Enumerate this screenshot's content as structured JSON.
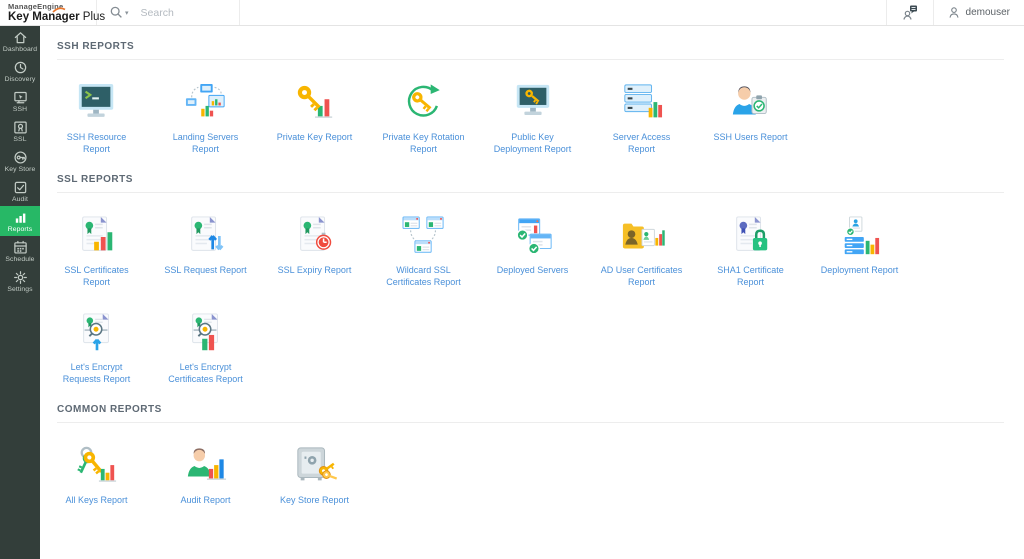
{
  "header": {
    "brand": {
      "line1": "ManageEngine",
      "line2": "Key Manager",
      "line2_suffix": "Plus"
    },
    "search": {
      "placeholder": "Search"
    },
    "user": {
      "name": "demouser"
    }
  },
  "sidebar": {
    "items": [
      {
        "label": "Dashboard",
        "icon": "home",
        "active": false
      },
      {
        "label": "Discovery",
        "icon": "discovery",
        "active": false
      },
      {
        "label": "SSH",
        "icon": "ssh",
        "active": false
      },
      {
        "label": "SSL",
        "icon": "ssl",
        "active": false
      },
      {
        "label": "Key Store",
        "icon": "keystore",
        "active": false
      },
      {
        "label": "Audit",
        "icon": "audit",
        "active": false
      },
      {
        "label": "Reports",
        "icon": "reports",
        "active": true
      },
      {
        "label": "Schedule",
        "icon": "schedule",
        "active": false
      },
      {
        "label": "Settings",
        "icon": "settings",
        "active": false
      }
    ]
  },
  "sections": [
    {
      "title": "SSH REPORTS",
      "reports": [
        {
          "label": "SSH Resource Report",
          "icon": "ssh-resource"
        },
        {
          "label": "Landing Servers Report",
          "icon": "landing-servers"
        },
        {
          "label": "Private Key Report",
          "icon": "private-key"
        },
        {
          "label": "Private Key Rotation Report",
          "icon": "private-key-rotation"
        },
        {
          "label": "Public Key Deployment Report",
          "icon": "public-key-deployment"
        },
        {
          "label": "Server Access Report",
          "icon": "server-access"
        },
        {
          "label": "SSH Users Report",
          "icon": "ssh-users"
        }
      ]
    },
    {
      "title": "SSL REPORTS",
      "reports": [
        {
          "label": "SSL Certificates Report",
          "icon": "ssl-certificates"
        },
        {
          "label": "SSL Request Report",
          "icon": "ssl-request"
        },
        {
          "label": "SSL Expiry Report",
          "icon": "ssl-expiry"
        },
        {
          "label": "Wildcard SSL Certificates Report",
          "icon": "wildcard-ssl"
        },
        {
          "label": "Deployed Servers",
          "icon": "deployed-servers"
        },
        {
          "label": "AD User Certificates Report",
          "icon": "ad-user-certificates"
        },
        {
          "label": "SHA1 Certificate Report",
          "icon": "sha1-certificate"
        },
        {
          "label": "Deployment Report",
          "icon": "deployment"
        },
        {
          "label": "Let's Encrypt Requests Report",
          "icon": "lets-encrypt-requests"
        },
        {
          "label": "Let's Encrypt Certificates Report",
          "icon": "lets-encrypt-certificates"
        }
      ]
    },
    {
      "title": "COMMON REPORTS",
      "reports": [
        {
          "label": "All Keys Report",
          "icon": "all-keys"
        },
        {
          "label": "Audit Report",
          "icon": "audit-person"
        },
        {
          "label": "Key Store Report",
          "icon": "key-store-safe"
        }
      ]
    }
  ],
  "colors": {
    "sidebar_bg": "#333e3a",
    "active_green": "#27b866",
    "link_blue": "#4a90d9",
    "section_title": "#5e6974",
    "logo_swoosh_orange": "#e8762d"
  }
}
